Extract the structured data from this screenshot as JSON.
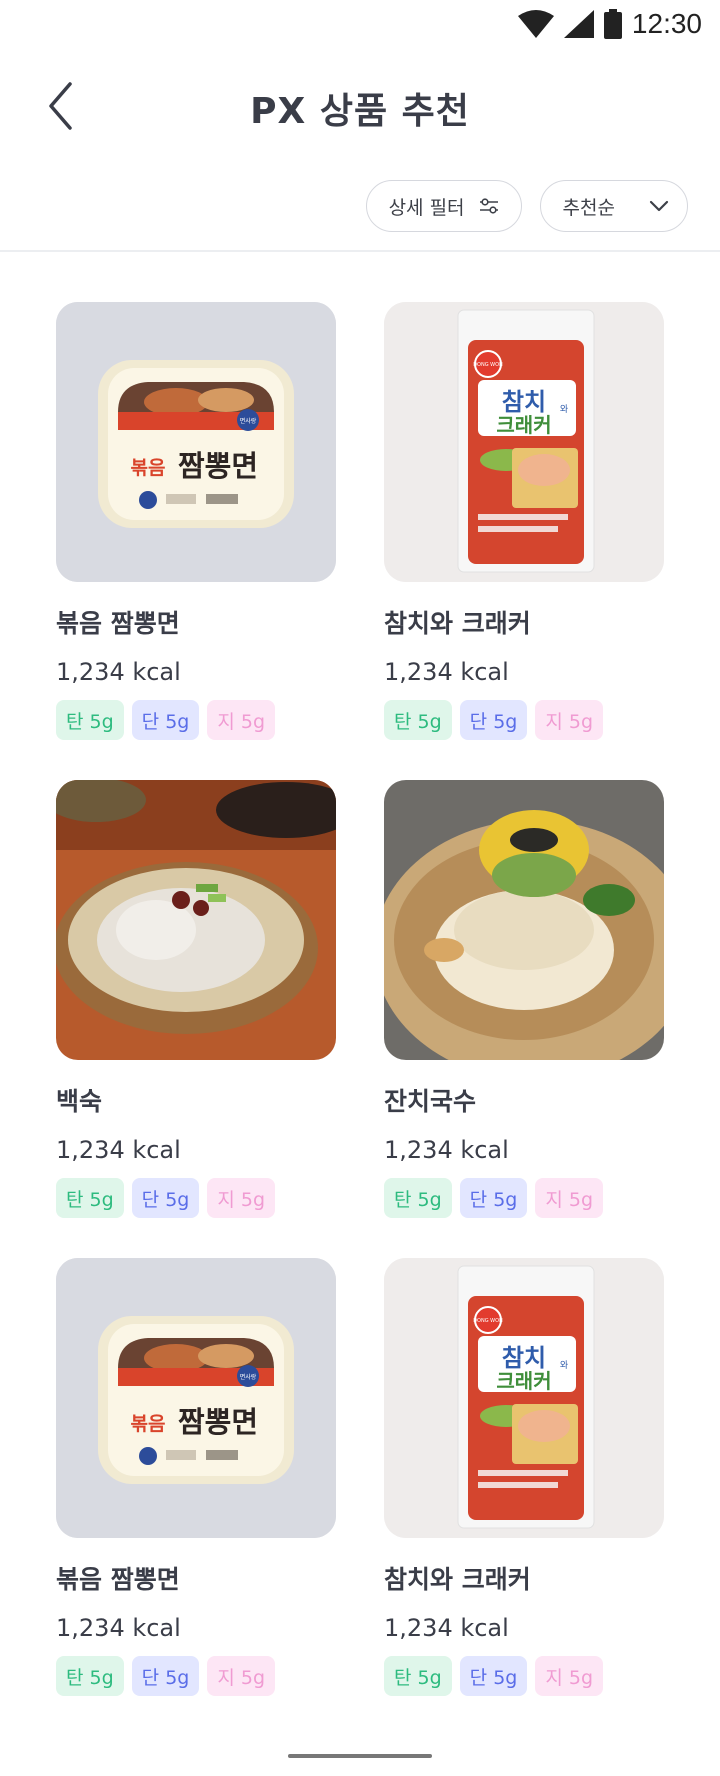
{
  "status": {
    "time": "12:30"
  },
  "header": {
    "title": "PX 상품 추천"
  },
  "filters": {
    "detail_label": "상세 필터",
    "sort_label": "추천순"
  },
  "products": [
    {
      "name": "볶음 짬뽕면",
      "kcal": "1,234 kcal",
      "carb": "탄 5g",
      "protein": "단 5g",
      "fat": "지 5g",
      "image": "noodle-package"
    },
    {
      "name": "참치와 크래커",
      "kcal": "1,234 kcal",
      "carb": "탄 5g",
      "protein": "단 5g",
      "fat": "지 5g",
      "image": "tuna-cracker-package"
    },
    {
      "name": "백숙",
      "kcal": "1,234 kcal",
      "carb": "탄 5g",
      "protein": "단 5g",
      "fat": "지 5g",
      "image": "chicken-soup-photo"
    },
    {
      "name": "잔치국수",
      "kcal": "1,234 kcal",
      "carb": "탄 5g",
      "protein": "단 5g",
      "fat": "지 5g",
      "image": "noodle-soup-photo"
    },
    {
      "name": "볶음 짬뽕면",
      "kcal": "1,234 kcal",
      "carb": "탄 5g",
      "protein": "단 5g",
      "fat": "지 5g",
      "image": "noodle-package"
    },
    {
      "name": "참치와 크래커",
      "kcal": "1,234 kcal",
      "carb": "탄 5g",
      "protein": "단 5g",
      "fat": "지 5g",
      "image": "tuna-cracker-package"
    }
  ],
  "package_text": {
    "noodle_brand": "면사랑",
    "noodle_label": "볶음",
    "noodle_title": "짬뽕면",
    "tuna_brand": "DONG WON",
    "tuna_title_1": "참치",
    "tuna_title_2": "크래커",
    "tuna_wa": "와"
  },
  "colors": {
    "accent": "#3a3d48",
    "carb": "#2dbb7f",
    "protein": "#5a6de8",
    "fat": "#f09bd2"
  }
}
